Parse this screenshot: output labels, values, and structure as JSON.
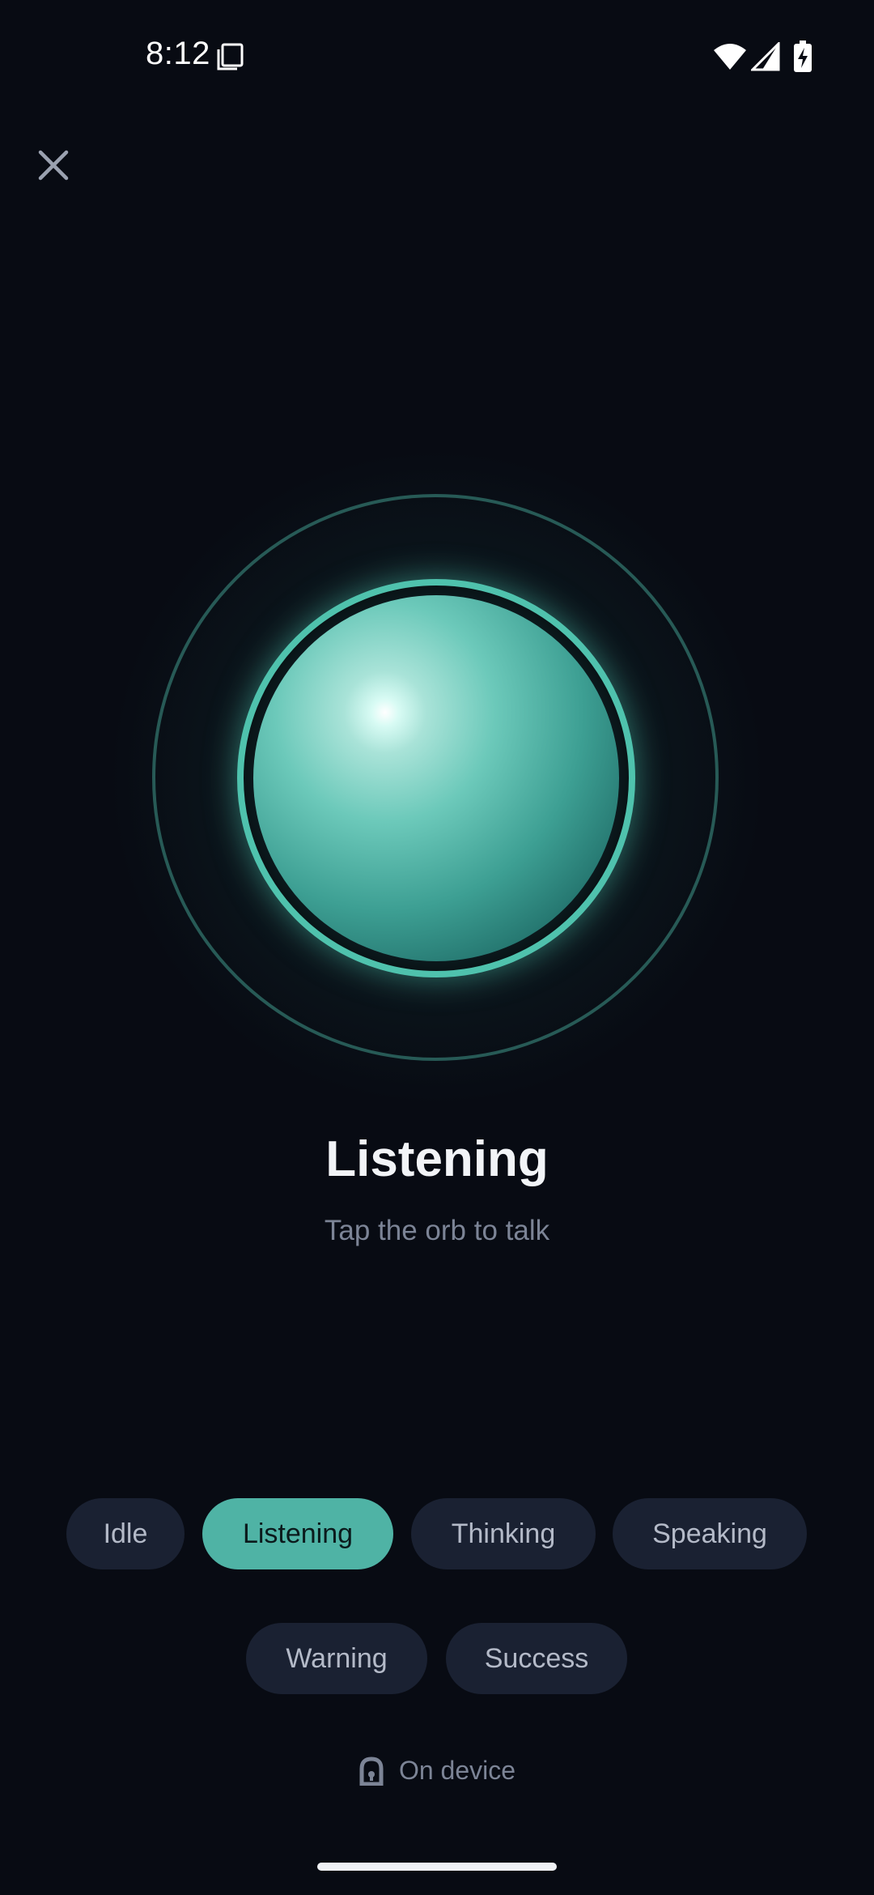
{
  "status_bar": {
    "time": "8:12",
    "icons": [
      "screen-icon",
      "wifi-icon",
      "signal-icon",
      "battery-charging-icon"
    ]
  },
  "header": {
    "close_icon": "close-icon"
  },
  "orb": {
    "state": "Listening",
    "accent_color": "#4fc2ad"
  },
  "state": {
    "title": "Listening",
    "subtitle": "Tap the orb to talk"
  },
  "modes": {
    "selected": "Listening",
    "items": [
      {
        "label": "Idle"
      },
      {
        "label": "Listening"
      },
      {
        "label": "Thinking"
      },
      {
        "label": "Speaking"
      },
      {
        "label": "Warning"
      },
      {
        "label": "Success"
      }
    ]
  },
  "footer": {
    "on_device_label": "On device",
    "icon": "lock-icon"
  },
  "colors": {
    "background": "#080b13",
    "chip_background": "#1a2132",
    "chip_active": "#4fb3a5",
    "muted_text": "#7c8496"
  }
}
